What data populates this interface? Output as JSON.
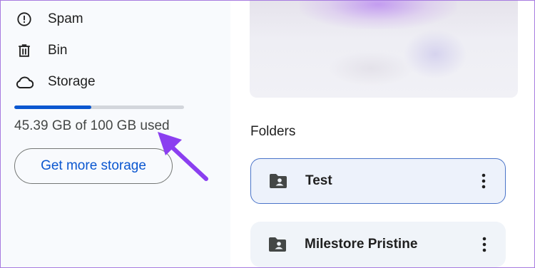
{
  "sidebar": {
    "items": [
      {
        "label": "Spam",
        "icon": "spam-icon"
      },
      {
        "label": "Bin",
        "icon": "trash-icon"
      },
      {
        "label": "Storage",
        "icon": "cloud-icon"
      }
    ],
    "storage": {
      "used_fraction": 0.4539,
      "text": "45.39 GB of 100 GB used",
      "button_label": "Get more storage"
    }
  },
  "main": {
    "folders_title": "Folders",
    "folders": [
      {
        "name": "Test",
        "selected": true
      },
      {
        "name": "Milestore Pristine",
        "selected": false
      }
    ]
  },
  "colors": {
    "accent": "#0b57d0",
    "annotation_arrow": "#8b3ff0",
    "frame_border": "#a77be0"
  }
}
